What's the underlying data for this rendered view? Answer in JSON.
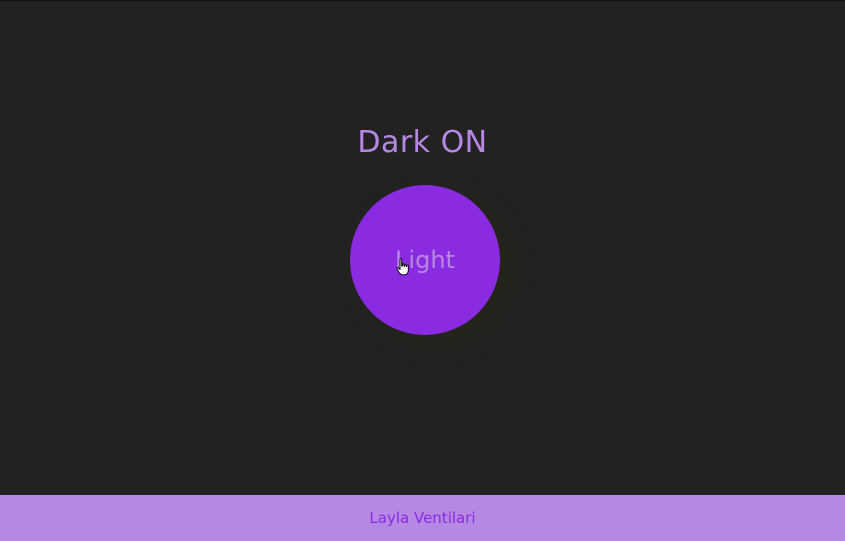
{
  "title": "Dark ON",
  "button": {
    "label": "Light"
  },
  "footer": {
    "author": "Layla Ventilari"
  },
  "colors": {
    "background": "#222222",
    "accent": "#8a2be2",
    "accent_light": "#b788e3"
  },
  "icons": {
    "cursor": "hand-pointer-icon"
  }
}
